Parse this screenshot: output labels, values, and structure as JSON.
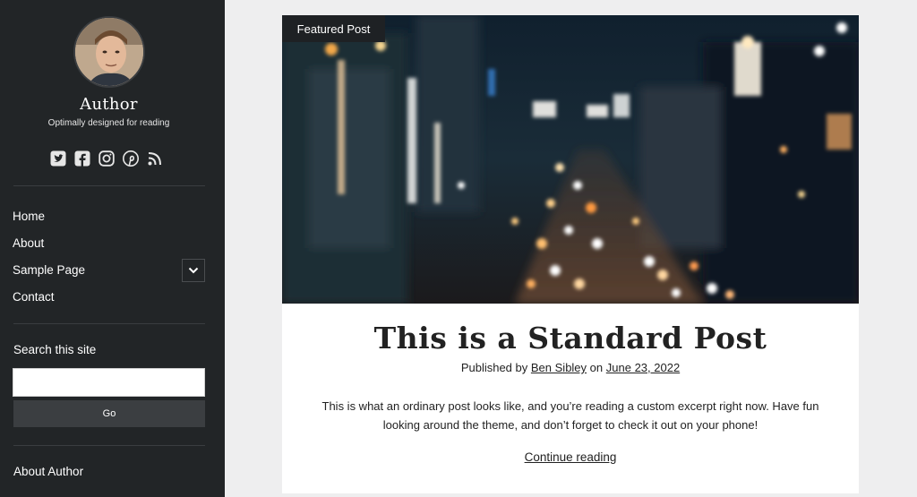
{
  "sidebar": {
    "site_title": "Author",
    "tagline": "Optimally designed for reading",
    "social_icons": [
      "twitter-icon",
      "facebook-icon",
      "instagram-icon",
      "pinterest-icon",
      "rss-icon"
    ],
    "menu": [
      {
        "label": "Home"
      },
      {
        "label": "About"
      },
      {
        "label": "Sample Page",
        "has_submenu": true
      },
      {
        "label": "Contact"
      }
    ],
    "search": {
      "label": "Search this site",
      "placeholder": "",
      "value": "",
      "button_label": "Go"
    },
    "about_heading": "About Author"
  },
  "post": {
    "badge": "Featured Post",
    "title": "This is a Standard Post",
    "byline_prefix": "Published by",
    "author": "Ben Sibley",
    "byline_on": "on",
    "date": "June 23, 2022",
    "excerpt": "This is what an ordinary post looks like, and you’re reading a custom excerpt right now. Have fun looking around the theme, and don’t forget to check it out on your phone!",
    "continue_label": "Continue reading"
  },
  "colors": {
    "sidebar_bg": "#222527",
    "page_bg": "#eeeeef",
    "card_bg": "#ffffff",
    "text": "#222222"
  }
}
